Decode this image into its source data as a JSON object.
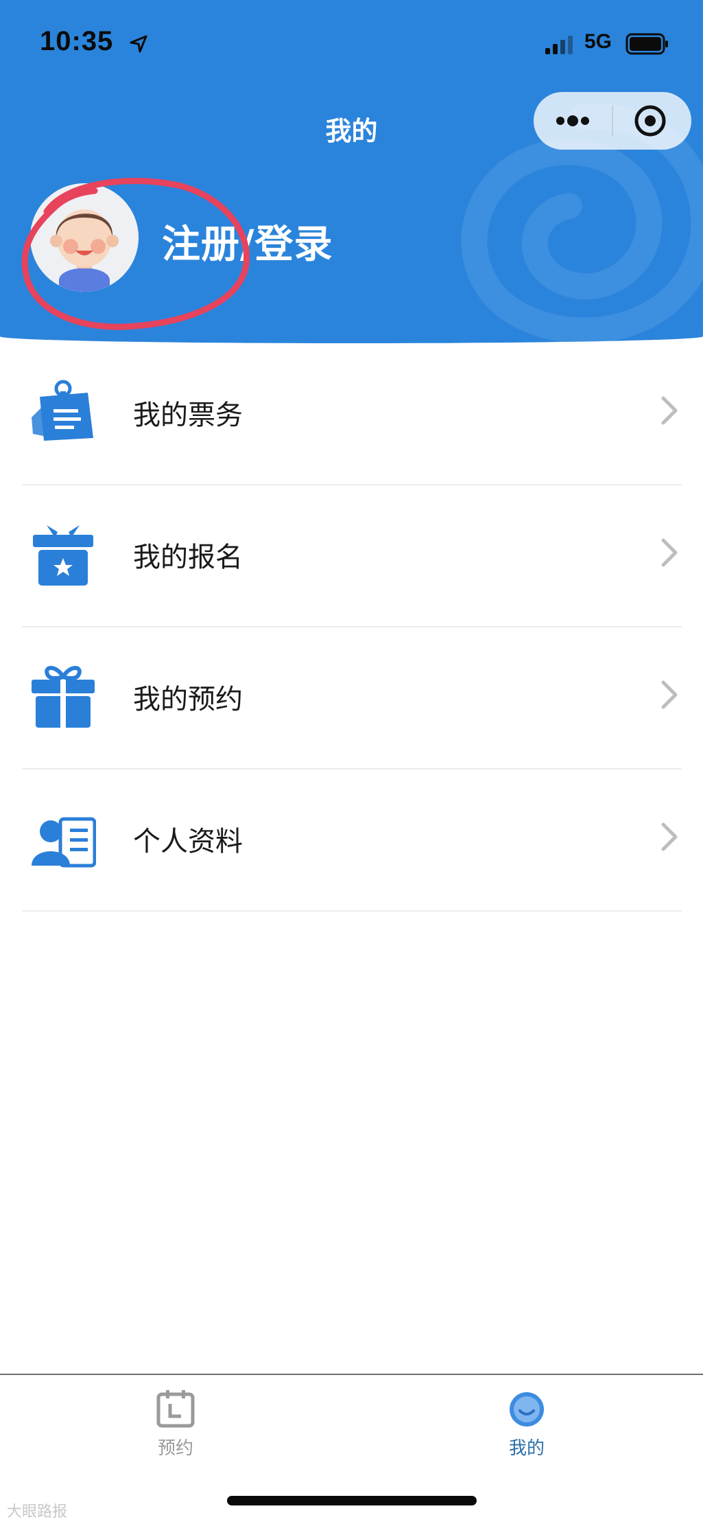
{
  "status_bar": {
    "time": "10:35",
    "network": "5G"
  },
  "nav": {
    "title": "我的"
  },
  "profile": {
    "login_label": "注册/登录"
  },
  "menu": {
    "items": [
      {
        "label": "我的票务",
        "icon": "ticket-icon"
      },
      {
        "label": "我的报名",
        "icon": "registration-box-icon"
      },
      {
        "label": "我的预约",
        "icon": "gift-icon"
      },
      {
        "label": "个人资料",
        "icon": "profile-card-icon"
      }
    ]
  },
  "tabbar": {
    "tabs": [
      {
        "label": "预约",
        "icon": "calendar-icon",
        "active": false
      },
      {
        "label": "我的",
        "icon": "user-circle-icon",
        "active": true
      }
    ]
  },
  "watermark": "大眼路报",
  "colors": {
    "header_blue": "#2b84db",
    "icon_blue": "#2a7fd8",
    "tab_active": "#2a6fa8",
    "tab_inactive": "#9a9a9a",
    "annotation_red": "#e8435c"
  }
}
